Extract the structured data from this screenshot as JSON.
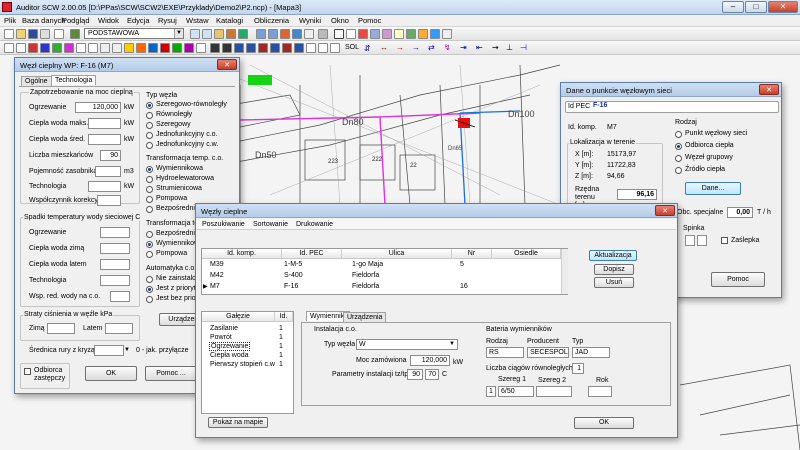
{
  "window": {
    "title": "Auditor SCW  2.00.05    [D:\\PPas\\SCW\\SCW2\\EXE\\Przyklady\\Demo2\\P2.ncp) - [Mapa3]",
    "min": "–",
    "max": "□",
    "close": "✕"
  },
  "menu": [
    "Plik",
    "Baza danych",
    "Podgląd",
    "Widok",
    "Edycja",
    "Rysuj",
    "Wstaw",
    "Katalogi",
    "Obliczenia",
    "Wyniki",
    "Okno",
    "Pomoc"
  ],
  "toolbar": {
    "layer_combo": "PODSTAWOWA",
    "sol_label": "SOL"
  },
  "map": {
    "labels": [
      "Dn80",
      "Dn50",
      "Dn100",
      "223",
      "222",
      "22",
      "Dn65"
    ]
  },
  "wezel": {
    "title": "Węzł cieplny WP: F-16 (M7)",
    "tabs": [
      "Ogólne",
      "Technologia"
    ],
    "zapotrzebowanie": {
      "title": "Zapotrzebowanie na moc cieplną",
      "ogrzewanie_label": "Ogrzewanie",
      "ogrzewanie_value": "120,000",
      "ogrzewanie_unit": "kW",
      "cwu_max_label": "Ciepła woda maks.",
      "cwu_max_unit": "kW",
      "cwu_sr_label": "Ciepła woda śred.",
      "cwu_sr_unit": "kW",
      "mieszkancow_label": "Liczba mieszkańców",
      "mieszkancow_value": "90",
      "zasobnik_label": "Pojemność zasobnika",
      "zasobnik_unit": "m3",
      "technologia_label": "Technologia",
      "technologia_unit": "kW",
      "wspolczynnik_label": "Współczynnik korekcyjny"
    },
    "typ_wezla": {
      "title": "Typ węzła",
      "options": [
        "Szeregowo-równoległy",
        "Równoległy",
        "Szeregowy",
        "Jednofunkcyjny c.o.",
        "Jednofunkcyjny c.w."
      ],
      "selected": 0
    },
    "transformacja_co": {
      "title": "Transformacja temp. c.o.",
      "options": [
        "Wymiennikowa",
        "Hydroelewatorowa",
        "Strumienicowa",
        "Pompowa",
        "Bezpośrednia"
      ],
      "selected": 0
    },
    "transformacja_cw": {
      "title": "Transformacja te",
      "options": [
        "Bezpośrednia",
        "Wymiennikowa",
        "Pompowa"
      ],
      "selected": 1
    },
    "automatyka": {
      "title": "Automatyka c.o.",
      "options": [
        "Nie zainstalowana",
        "Jest z priorytetem",
        "Jest bez priorytetu"
      ],
      "selected": 1
    },
    "spadki": {
      "title": "Spadki temperatury wody sieciowej  C",
      "rows": [
        "Ogrzewanie",
        "Ciepła woda zimą",
        "Ciepła woda latem",
        "Technologia",
        "Wsp. red.  wody na c.o."
      ]
    },
    "straty": {
      "title": "Straty ciśnienia w węźle kPa",
      "zima": "Zimą",
      "latem": "Latem"
    },
    "srednica": {
      "label": "Średnica rury z kryzą",
      "hint": "0 - jak. przyłącze"
    },
    "urzadzenia_btn": "Urządzenia",
    "odbiorca_label": "Odbiorca zastępczy",
    "ok": "OK",
    "pomoc": "Pomoc ..."
  },
  "dane": {
    "title": "Dane o punkcie węzłowym sieci",
    "id_pec_label": "Id PEC",
    "id_pec_value": "F-16",
    "id_komp_label": "Id. komp.",
    "id_komp_value": "M7",
    "lokalizacja_title": "Lokalizacja w terenie",
    "x_label": "X [m]:",
    "x_value": "15173,97",
    "y_label": "Y [m]:",
    "y_value": "11722,83",
    "z_label": "Z [m]:",
    "z_value": "94,66",
    "rzedna_label": "Rzędna terenu [m]",
    "rzedna_value": "96,16",
    "rodzaj_title": "Rodzaj",
    "rodzaj_options": [
      "Punkt węzłowy sieci",
      "Odbiorca ciepła",
      "Węzeł grupowy",
      "Źródło ciepła"
    ],
    "rodzaj_selected": 1,
    "dane_btn": "Dane...",
    "obc_label": "Obc. specjalne",
    "obc_value": "0,00",
    "obc_unit": "T / h",
    "spinka_label": "Spinka",
    "zaslepka_label": "Zaślepka",
    "pomoc": "Pomoc"
  },
  "wezly": {
    "title": "Węzły cieplne",
    "menu": [
      "Poszukiwanie",
      "Sortowanie",
      "Drukowanie"
    ],
    "columns": [
      "Id. komp.",
      "Id. PEC",
      "Ulica",
      "Nr",
      "Osiedle"
    ],
    "rows": [
      [
        "M39",
        "1-M-5",
        "1-go Maja",
        "5",
        ""
      ],
      [
        "M42",
        "S-400",
        "Fieldorfa",
        "",
        ""
      ],
      [
        "M7",
        "F-16",
        "Fieldorfa",
        "16",
        ""
      ]
    ],
    "current_marker": "▶",
    "selected_row": 2,
    "aktualizacja": "Aktualizacja",
    "dopisz": "Dopisz",
    "usun": "Usuń",
    "galezie_columns": [
      "Gałęzie",
      "Id."
    ],
    "galezie": [
      [
        "Zasilanie",
        "1"
      ],
      [
        "Powrót",
        "1"
      ],
      [
        "Ogrzewanie",
        "1"
      ],
      [
        "Ciepła woda",
        "1"
      ],
      [
        "Pierwszy stopień c.w",
        "1"
      ]
    ],
    "galezie_selected": 2,
    "pokaz_btn": "Pokaż na mapie",
    "sub_tabs": [
      "Wymienniki",
      "Urządzenia"
    ],
    "instalacja": {
      "title": "Instalacja c.o.",
      "typ_label": "Typ węzła",
      "typ_value": "W",
      "moc_label": "Moc zamówiona",
      "moc_value": "120,000",
      "moc_unit": "kW",
      "param_label": "Parametry instalacji tz/tp",
      "tz": "90",
      "tp": "70",
      "param_unit": "C"
    },
    "baterie": {
      "title": "Bateria wymienników",
      "rodzaj_label": "Rodzaj",
      "producent_label": "Producent",
      "typ_label": "Typ",
      "rodzaj": "RS",
      "producent": "SECESPOL",
      "typ": "JAD",
      "ciagow_label": "Liczba ciągów równoległych",
      "ciagow_value": "1",
      "szereg1_label": "Szereg 1",
      "szereg2_label": "Szereg 2",
      "rok_label": "Rok",
      "szereg1_num": "1",
      "szereg1_value": "6/50"
    },
    "ok": "OK"
  }
}
